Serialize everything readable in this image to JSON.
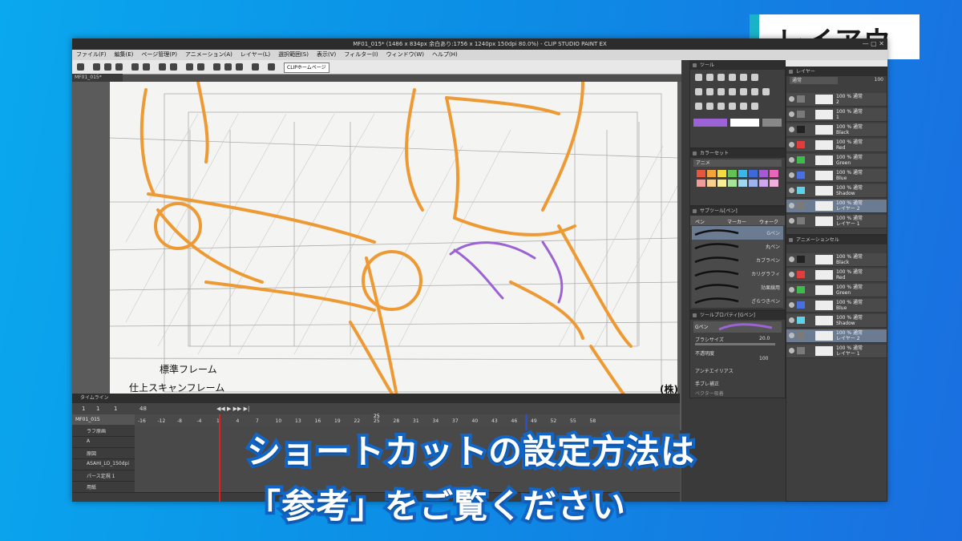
{
  "badge": {
    "label": "レイアウト"
  },
  "window": {
    "title": "MF01_015* (1486 x 834px 余白あり:1756 x 1240px 150dpi 80.0%) - CLIP STUDIO PAINT EX",
    "doc_tab": "MF01_015*",
    "menu": [
      "ファイル(F)",
      "編集(E)",
      "ページ管理(P)",
      "アニメーション(A)",
      "レイヤー(L)",
      "選択範囲(S)",
      "表示(V)",
      "フィルター(I)",
      "ウィンドウ(W)",
      "ヘルプ(H)"
    ],
    "command_bar": {
      "homepage_button": "CLIPホームページ"
    }
  },
  "canvas": {
    "frame_labels": {
      "standard": "標準フレーム",
      "scan": "仕上スキャンフレーム",
      "company": "(株)旭"
    }
  },
  "panels": {
    "tool": {
      "title": "ツール"
    },
    "color_set": {
      "title": "カラーセット",
      "set_name": "アニメ",
      "swatches": [
        "#e8553d",
        "#f2a33a",
        "#f3dc3e",
        "#64c153",
        "#3bb6e6",
        "#3e6ad8",
        "#a45ad6",
        "#e866b8",
        "#f29b9b",
        "#f6cf91",
        "#f8ef95",
        "#a9e39b",
        "#9ed9f2",
        "#9eb4ef",
        "#cfa6ed",
        "#f2b0dd"
      ]
    },
    "sub_tool": {
      "title": "サブツール[ペン]",
      "tabs": [
        "ペン",
        "マーカー",
        "ウォーク"
      ],
      "brushes": [
        "Gペン",
        "丸ペン",
        "カブラペン",
        "カリグラフィ",
        "効果線用",
        "ざらつきペン"
      ],
      "selected": 0
    },
    "tool_property": {
      "title": "ツールプロパティ[Gペン]",
      "tab": "Gペン",
      "rows": [
        {
          "label": "ブラシサイズ",
          "value": "20.0"
        },
        {
          "label": "不透明度",
          "value": "100"
        },
        {
          "label": "アンチエイリアス",
          "value": ""
        },
        {
          "label": "手ブレ補正",
          "value": ""
        },
        {
          "label": "ベクター吸着",
          "value": ""
        }
      ]
    },
    "layer": {
      "title": "レイヤー",
      "blend": "通常",
      "opacity": "100",
      "rows": [
        {
          "text": "100 % 通常\n2",
          "label_color": "#7a7a7a",
          "sel": false
        },
        {
          "text": "100 % 通常\n1",
          "label_color": "#7a7a7a",
          "sel": false
        },
        {
          "text": "100 % 通常\nBlack",
          "label_color": "#222222",
          "sel": false
        },
        {
          "text": "100 % 通常\nRed",
          "label_color": "#e23c3c",
          "sel": false
        },
        {
          "text": "100 % 通常\nGreen",
          "label_color": "#3cbd4a",
          "sel": false
        },
        {
          "text": "100 % 通常\nBlue",
          "label_color": "#4a6fe0",
          "sel": false
        },
        {
          "text": "100 % 通常\nShadow",
          "label_color": "#5cd3e8",
          "sel": false
        },
        {
          "text": "100 % 通常\nレイヤー 2",
          "label_color": "#7a7a7a",
          "sel": true
        },
        {
          "text": "100 % 通常\nレイヤー 1",
          "label_color": "#7a7a7a",
          "sel": false
        }
      ]
    },
    "animation_cel": {
      "title": "アニメーションセル",
      "rows": [
        {
          "text": "100 % 通常\nBlack",
          "label_color": "#222222",
          "sel": false
        },
        {
          "text": "100 % 通常\nRed",
          "label_color": "#e23c3c",
          "sel": false
        },
        {
          "text": "100 % 通常\nGreen",
          "label_color": "#3cbd4a",
          "sel": false
        },
        {
          "text": "100 % 通常\nBlue",
          "label_color": "#4a6fe0",
          "sel": false
        },
        {
          "text": "100 % 通常\nShadow",
          "label_color": "#5cd3e8",
          "sel": false
        },
        {
          "text": "100 % 通常\nレイヤー 2",
          "label_color": "#7a7a7a",
          "sel": true
        },
        {
          "text": "100 % 通常\nレイヤー 1",
          "label_color": "#7a7a7a",
          "sel": false
        }
      ]
    }
  },
  "timeline": {
    "title": "タイムライン",
    "frame_fields": [
      "1",
      "1",
      "1",
      "48"
    ],
    "name": "MF01_015",
    "ruler": [
      "-16",
      "-12",
      "-8",
      "-4",
      "1",
      "4",
      "7",
      "10",
      "13",
      "16",
      "19",
      "22",
      "25",
      "28",
      "31",
      "34",
      "37",
      "40",
      "43",
      "46",
      "49",
      "52",
      "55",
      "58"
    ],
    "marker": "25",
    "tracks": [
      "ラフ原画",
      "A",
      "原図",
      "ASAHI_LO_150dpi",
      "パース定規 1",
      "用紙"
    ]
  },
  "captions": {
    "line1": "ショートカットの設定方法は",
    "line2": "「参考」をご覧ください"
  }
}
